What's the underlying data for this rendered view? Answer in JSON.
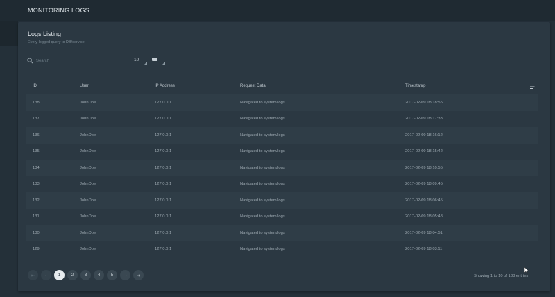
{
  "header": {
    "title": "MONITORING LOGS"
  },
  "card": {
    "title": "Logs Listing",
    "subtitle": "Every logged query to DB/service"
  },
  "controls": {
    "search_placeholder": "Search",
    "page_size": "10",
    "search_icon": "search-icon",
    "view_icon": "grid-view-icon"
  },
  "table": {
    "columns": [
      "ID",
      "User",
      "IP Address",
      "Request Data",
      "Timestamp"
    ],
    "sort_icon": "sort-lines-icon",
    "rows": [
      {
        "id": "138",
        "user": "JohnDoe",
        "ip": "127.0.0.1",
        "request": "Navigated to system/logs",
        "timestamp": "2017-02-09 18:18:55"
      },
      {
        "id": "137",
        "user": "JohnDoe",
        "ip": "127.0.0.1",
        "request": "Navigated to system/logs",
        "timestamp": "2017-02-09 18:17:33"
      },
      {
        "id": "136",
        "user": "JohnDoe",
        "ip": "127.0.0.1",
        "request": "Navigated to system/logs",
        "timestamp": "2017-02-09 18:16:12"
      },
      {
        "id": "135",
        "user": "JohnDoe",
        "ip": "127.0.0.1",
        "request": "Navigated to system/logs",
        "timestamp": "2017-02-09 18:15:42"
      },
      {
        "id": "134",
        "user": "JohnDoe",
        "ip": "127.0.0.1",
        "request": "Navigated to system/logs",
        "timestamp": "2017-02-09 18:10:55"
      },
      {
        "id": "133",
        "user": "JohnDoe",
        "ip": "127.0.0.1",
        "request": "Navigated to system/logs",
        "timestamp": "2017-02-09 18:09:45"
      },
      {
        "id": "132",
        "user": "JohnDoe",
        "ip": "127.0.0.1",
        "request": "Navigated to system/logs",
        "timestamp": "2017-02-09 18:06:45"
      },
      {
        "id": "131",
        "user": "JohnDoe",
        "ip": "127.0.0.1",
        "request": "Navigated to system/logs",
        "timestamp": "2017-02-09 18:05:48"
      },
      {
        "id": "130",
        "user": "JohnDoe",
        "ip": "127.0.0.1",
        "request": "Navigated to system/logs",
        "timestamp": "2017-02-09 18:04:51"
      },
      {
        "id": "129",
        "user": "JohnDoe",
        "ip": "127.0.0.1",
        "request": "Navigated to system/logs",
        "timestamp": "2017-02-09 18:03:11"
      }
    ]
  },
  "pagination": {
    "first": "⇤",
    "prev": "←",
    "pages": [
      "1",
      "2",
      "3",
      "4",
      "5"
    ],
    "current": "1",
    "next": "→",
    "last": "⇥",
    "info": "Showing 1 to 10 of 138 entries"
  },
  "colors": {
    "background": "#243039",
    "card": "#2b3842",
    "active_page": "#e6ebee"
  }
}
